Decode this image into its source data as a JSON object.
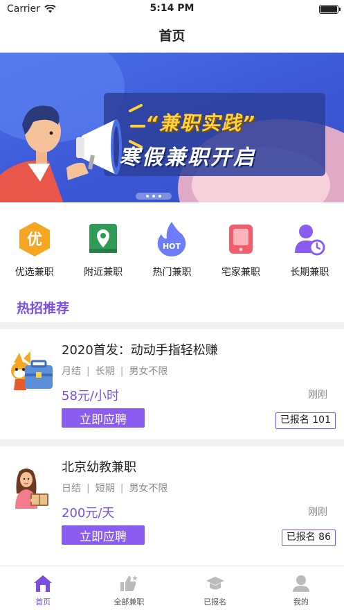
{
  "status_bar": {
    "carrier": "Carrier",
    "time": "5:14 PM"
  },
  "nav": {
    "title": "首页"
  },
  "banner": {
    "headline": "“兼职实践”",
    "subline": "寒假兼职开启"
  },
  "categories": [
    {
      "label": "优选兼职",
      "icon": "premium-icon",
      "glyph": "优",
      "color": "#f5a623"
    },
    {
      "label": "附近兼职",
      "icon": "map-pin-icon",
      "color": "#2f9b56"
    },
    {
      "label": "热门兼职",
      "icon": "hot-flame-icon",
      "glyph": "HOT",
      "color": "#6d7cf7"
    },
    {
      "label": "宅家兼职",
      "icon": "tablet-icon",
      "color": "#f15d6b"
    },
    {
      "label": "长期兼职",
      "icon": "user-clock-icon",
      "color": "#8a5cf0"
    }
  ],
  "section": {
    "title": "热招推荐"
  },
  "jobs": [
    {
      "title": "2020首发：动动手指轻松赚",
      "tags": [
        "月结",
        "长期",
        "男女不限"
      ],
      "salary": "58元/小时",
      "time": "刚刚",
      "apply_label": "立即应聘",
      "count_label": "已报名 101"
    },
    {
      "title": "北京幼教兼职",
      "tags": [
        "日结",
        "短期",
        "男女不限"
      ],
      "salary": "200元/天",
      "time": "刚刚",
      "apply_label": "立即应聘",
      "count_label": "已报名 86"
    }
  ],
  "tabs": [
    {
      "label": "首页",
      "icon": "home-icon",
      "active": true
    },
    {
      "label": "全部兼职",
      "icon": "thumbs-up-icon",
      "active": false
    },
    {
      "label": "已报名",
      "icon": "graduation-cap-icon",
      "active": false
    },
    {
      "label": "我的",
      "icon": "user-icon",
      "active": false
    }
  ],
  "colors": {
    "accent": "#7b4fe3",
    "button": "#8b5cf0"
  }
}
